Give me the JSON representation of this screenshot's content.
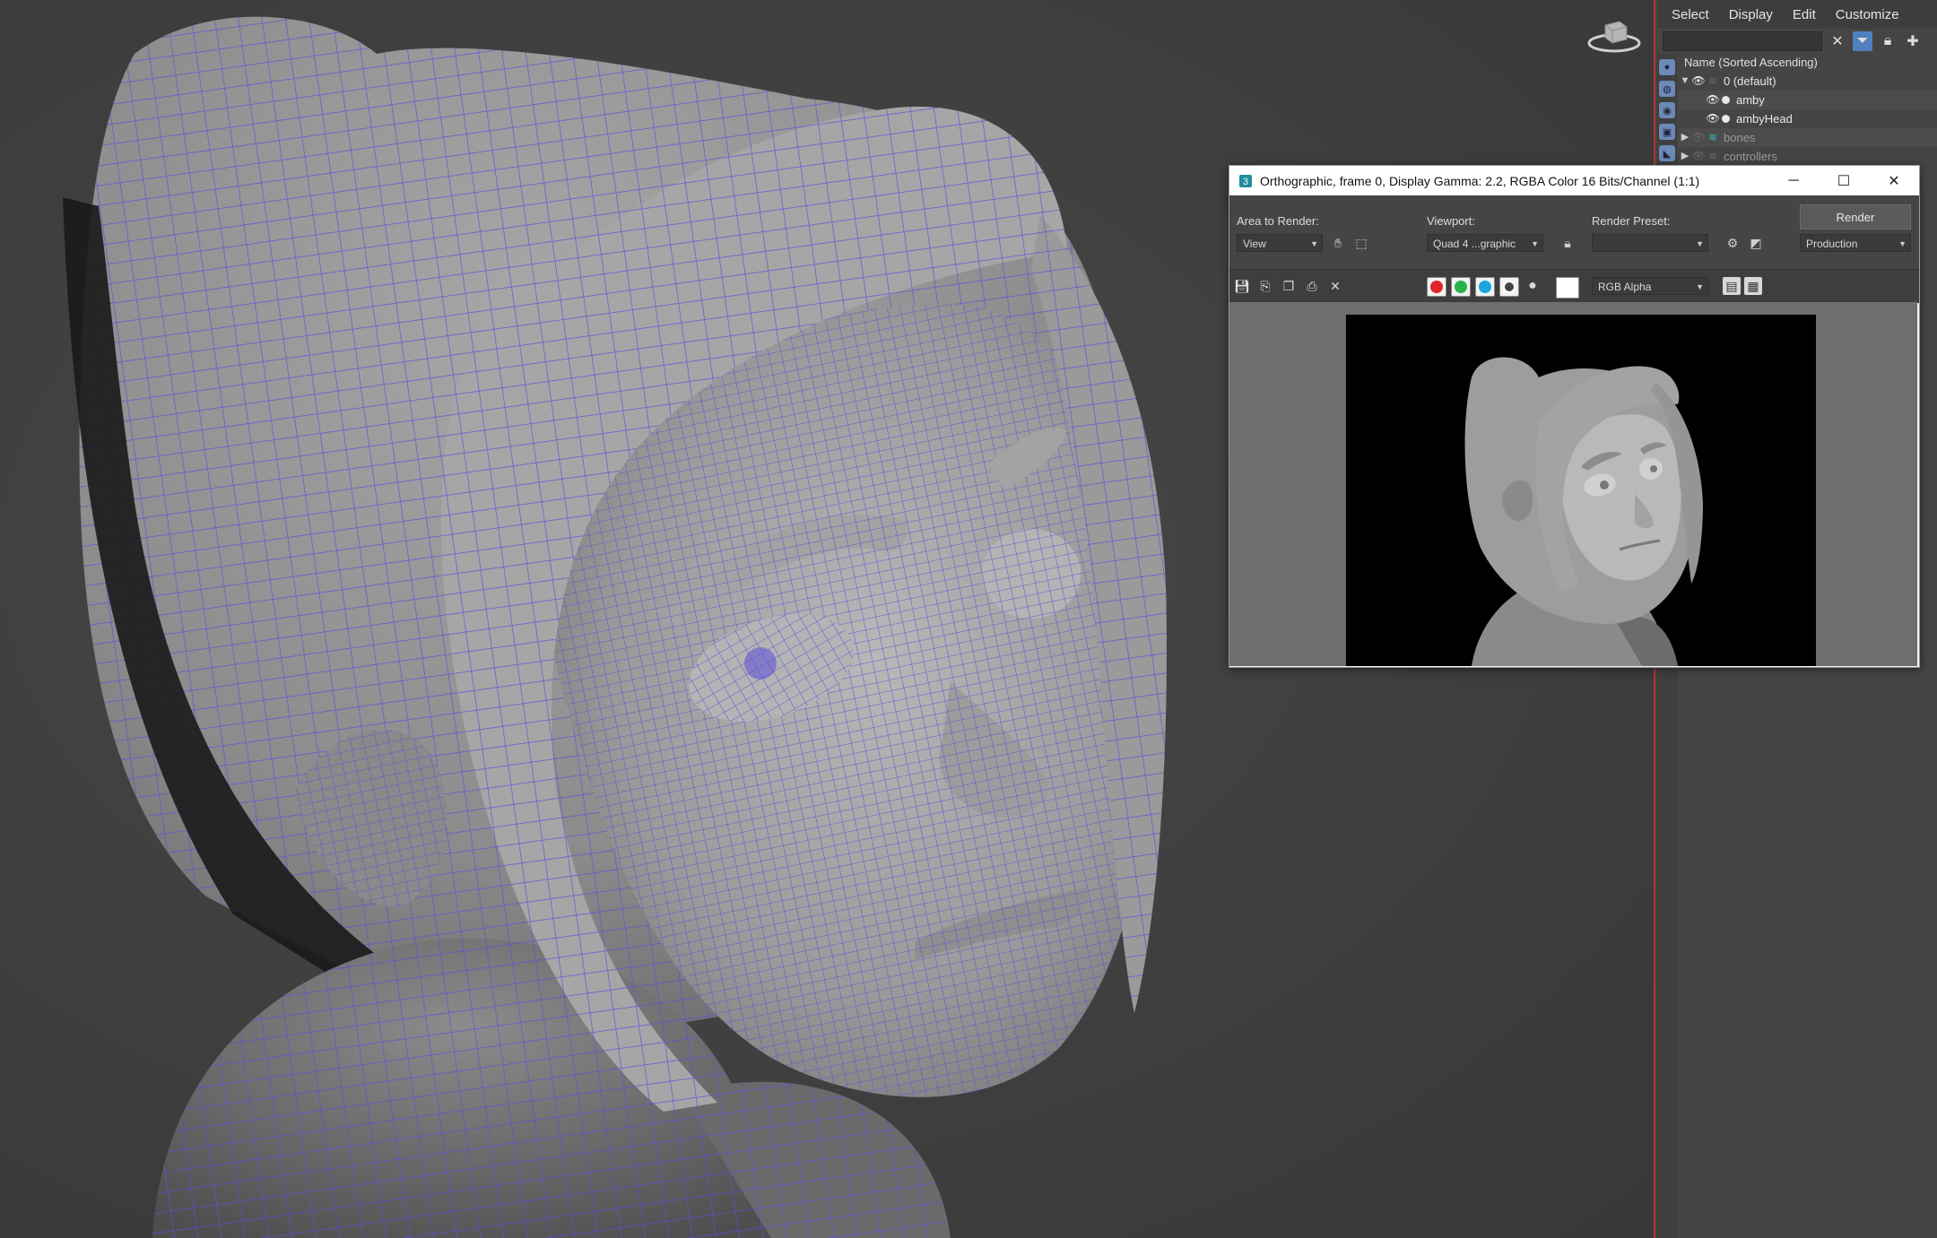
{
  "explorer": {
    "menu": [
      "Select",
      "Display",
      "Edit",
      "Customize"
    ],
    "column_header": "Name (Sorted Ascending)",
    "rows": [
      {
        "label": "0 (default)",
        "type": "layer",
        "expanded": true
      },
      {
        "label": "amby",
        "type": "object"
      },
      {
        "label": "ambyHead",
        "type": "object"
      },
      {
        "label": "bones",
        "type": "layer",
        "expanded": false
      },
      {
        "label": "controllers",
        "type": "layer",
        "expanded": false
      }
    ]
  },
  "render_window": {
    "title": "Orthographic, frame 0, Display Gamma: 2.2, RGBA Color 16 Bits/Channel (1:1)",
    "area_label": "Area to Render:",
    "area_value": "View",
    "viewport_label": "Viewport:",
    "viewport_value": "Quad 4 ...graphic",
    "preset_label": "Render Preset:",
    "preset_value": "",
    "render_button": "Render",
    "production_value": "Production",
    "channel_value": "RGB Alpha"
  },
  "colors": {
    "wireframe": "#5c4fd9",
    "viewport_bg": "#404040",
    "active_border": "#b9332e",
    "accent": "#4f7fbf"
  }
}
